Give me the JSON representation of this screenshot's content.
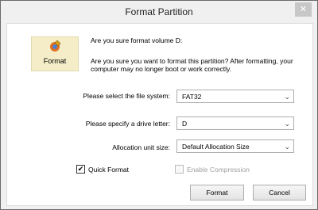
{
  "window": {
    "title": "Format Partition",
    "close_glyph": "✕"
  },
  "logo": {
    "label": "Format",
    "icon": "format-icon"
  },
  "question": {
    "heading": "Are you sure format volume D:",
    "body": "Are you sure you want to format this partition? After formatting, your computer may no longer boot or work correctly."
  },
  "fields": {
    "filesystem": {
      "label": "Please select the file system:",
      "value": "FAT32"
    },
    "drive_letter": {
      "label": "Please specify a drive letter:",
      "value": "D"
    },
    "allocation": {
      "label": "Allocation unit size:",
      "value": "Default Allocation Size"
    }
  },
  "options": {
    "quick_format": {
      "label": "Quick Format",
      "checked": true,
      "check_glyph": "✔"
    },
    "enable_compression": {
      "label": "Enable Compression",
      "checked": false,
      "enabled": false
    }
  },
  "buttons": {
    "format": "Format",
    "cancel": "Cancel"
  },
  "colors": {
    "logo_bg": "#f4edc8",
    "close_bg": "#c7c7c7"
  }
}
